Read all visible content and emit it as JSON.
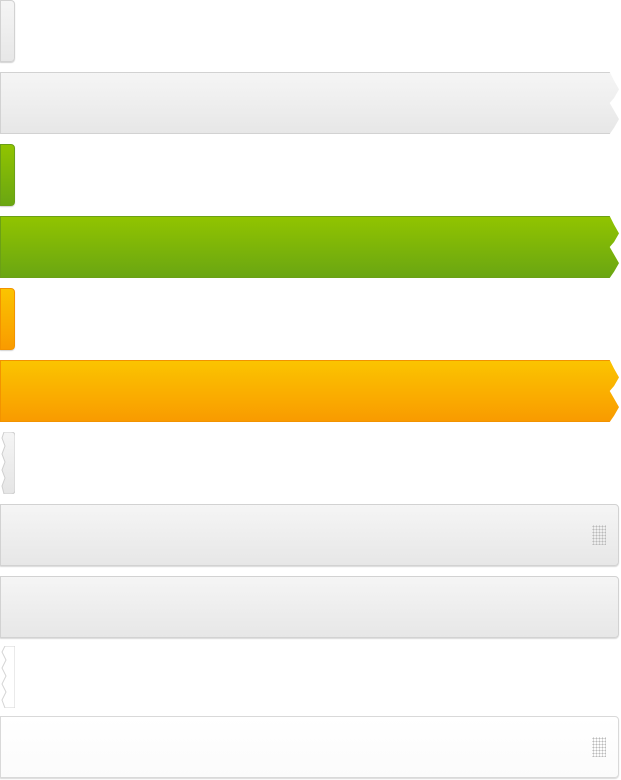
{
  "palette": {
    "gray_top": "#f5f5f5",
    "gray_bottom": "#e7e7e7",
    "green_top": "#91c400",
    "green_bottom": "#6aa612",
    "orange_top": "#fbc400",
    "orange_bottom": "#f99b00",
    "white": "#ffffff"
  },
  "tiles": [
    {
      "kind": "cap",
      "style": "gray"
    },
    {
      "kind": "ribbon-bar",
      "style": "gray"
    },
    {
      "kind": "cap",
      "style": "green"
    },
    {
      "kind": "ribbon-bar",
      "style": "green"
    },
    {
      "kind": "cap",
      "style": "orange"
    },
    {
      "kind": "ribbon-bar",
      "style": "orange"
    },
    {
      "kind": "torn-cap",
      "style": "gray"
    },
    {
      "kind": "grip-bar",
      "style": "gray",
      "icon": "grip-dots-icon"
    },
    {
      "kind": "bar",
      "style": "gray"
    },
    {
      "kind": "torn-cap",
      "style": "white"
    },
    {
      "kind": "grip-bar",
      "style": "white",
      "icon": "grip-dots-icon"
    }
  ]
}
